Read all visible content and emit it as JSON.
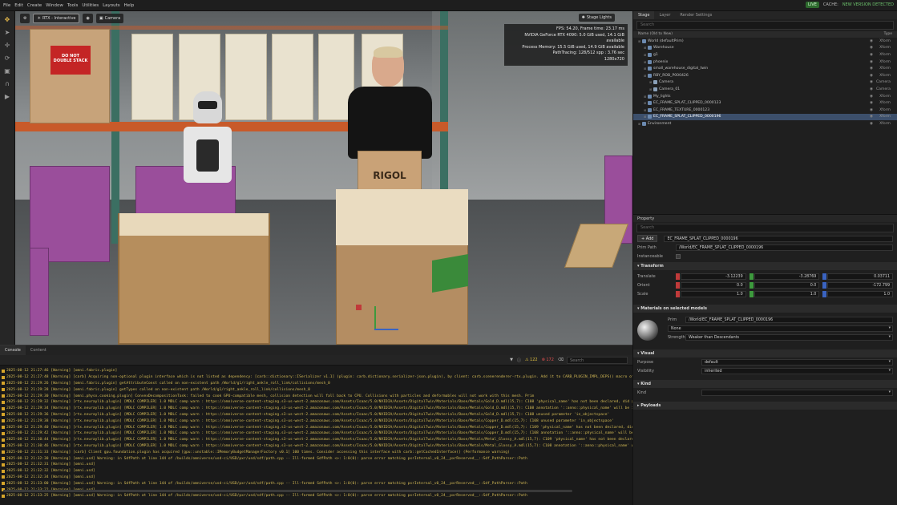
{
  "menu": [
    "File",
    "Edit",
    "Create",
    "Window",
    "Tools",
    "Utilities",
    "Layouts",
    "Help"
  ],
  "status": {
    "live": "LIVE",
    "cache": "CACHE:",
    "new_version": "NEW VERSION DETECTED"
  },
  "viewport": {
    "camera_mode": "RTX - Interactive",
    "camera": "Camera",
    "stage_lights": "Stage Lights",
    "stats": [
      "FPS: 54.20, Frame time: 23.17 ms",
      "NVIDIA GeForce RTX 4090: 5.0 GiB used, 14.1 GiB available",
      "Process Memory: 15.5 GiB used, 14.9 GiB available",
      "PathTracing: 128/512 spp : 3.76 sec",
      "1280x720"
    ],
    "scene_text": {
      "do_not_stack": "DO NOT\nDOUBLE STACK",
      "rigol": "RIGOL"
    }
  },
  "console": {
    "tabs": [
      "Console",
      "Content"
    ],
    "warn_count": "122",
    "error_count": "172",
    "search_placeholder": "Search",
    "lines": [
      {
        "t": "warn",
        "text": "2025-08-12 21:27:46 [Warning] [omni.fabric.plugin]"
      },
      {
        "t": "warn",
        "text": "2025-08-12 21:27:48 [Warning] [carb] Acquiring non-optional plugin interface which is not listed as dependency: [carb::dictionary::ISerializer v1.1] (plugin: carb.dictionary.serializer-json.plugin), by client: carb.scenerenderer-rtx.plugin. Add it to CARB_PLUGIN_IMPL_DEPS() macro of a client."
      },
      {
        "t": "warn",
        "text": "2025-08-12 21:29:26 [Warning] [omni.fabric.plugin] getAttributeConst called on non-existent path /World/g1/right_ankle_roll_link/collisions/mesh_0"
      },
      {
        "t": "warn",
        "text": "2025-08-12 21:29:28 [Warning] [omni.fabric.plugin] getTypes called on non-existent path /World/g1/right_ankle_roll_link/collisions/mesh_0"
      },
      {
        "t": "warn",
        "text": "2025-08-12 21:29:30 [Warning] [omni.physx.cooking.plugin] ConvexDecompositionTask: failed to cook GPU-compatible mesh, collision detection will fall back to CPU. Collisions with particles and deformables will not work with this mesh. Prim"
      },
      {
        "t": "warn",
        "text": "2025-08-12 21:29:32 [Warning] [rtx.neuraylib.plugin] [MDLC COMPILER]   1.0   MDLC   comp warn : https://omniverse-content-staging.s3-us-west-2.amazonaws.com/Assets/Isaac/5.0/NVIDIA/Assets/DigitalTwin/Materials/Base/Metals/Gold_D.mdl(15,7): C108 'physical_name' has not been declared, did yo"
      },
      {
        "t": "warn",
        "text": "2025-08-12 21:29:34 [Warning] [rtx.neuraylib.plugin] [MDLC COMPILER]   1.0   MDLC   comp warn : https://omniverse-content-staging.s3-us-west-2.amazonaws.com/Assets/Isaac/5.0/NVIDIA/Assets/DigitalTwin/Materials/Base/Metals/Gold_D.mdl(15,7): C108 annotation '::anno::physical_name' will be ignor"
      },
      {
        "t": "warn",
        "text": "2025-08-12 21:29:36 [Warning] [rtx.neuraylib.plugin] [MDLC COMPILER]   1.0   MDLC   comp warn : https://omniverse-content-staging.s3-us-west-2.amazonaws.com/Assets/Isaac/5.0/NVIDIA/Assets/DigitalTwin/Materials/Base/Metals/Gold_D.mdl(15,7): C108 unused parameter 'in_objectspace'"
      },
      {
        "t": "warn",
        "text": "2025-08-12 21:29:38 [Warning] [rtx.neuraylib.plugin] [MDLC COMPILER]   1.0   MDLC   comp warn : https://omniverse-content-staging.s3-us-west-2.amazonaws.com/Assets/Isaac/5.0/NVIDIA/Assets/DigitalTwin/Materials/Base/Metals/Copper_D.mdl(15,7): C108 unused parameter 'in_objectspace'"
      },
      {
        "t": "warn",
        "text": "2025-08-12 21:29:40 [Warning] [rtx.neuraylib.plugin] [MDLC COMPILER]   1.0   MDLC   comp warn : https://omniverse-content-staging.s3-us-west-2.amazonaws.com/Assets/Isaac/5.0/NVIDIA/Assets/DigitalTwin/Materials/Base/Metals/Copper_D.mdl(15,7): C109 'physical_name' has not been declared, did yo"
      },
      {
        "t": "warn",
        "text": "2025-08-12 21:29:42 [Warning] [rtx.neuraylib.plugin] [MDLC COMPILER]   1.0   MDLC   comp warn : https://omniverse-content-staging.s3-us-west-2.amazonaws.com/Assets/Isaac/5.0/NVIDIA/Assets/DigitalTwin/Materials/Base/Metals/Copper_D.mdl(15,7): C108 annotation '::anno::physical_name' will be ign"
      },
      {
        "t": "warn",
        "text": "2025-08-12 21:30:44 [Warning] [rtx.neuraylib.plugin] [MDLC COMPILER]   1.0   MDLC   comp warn : https://omniverse-content-staging.s3-us-west-2.amazonaws.com/Assets/Isaac/5.0/NVIDIA/Assets/DigitalTwin/Materials/Base/Metals/Metal_Glossy_A.mdl(15,7): C109 'physical_name' has not been declared"
      },
      {
        "t": "warn",
        "text": "2025-08-12 21:30:46 [Warning] [rtx.neuraylib.plugin] [MDLC COMPILER]   1.0   MDLC   comp warn : https://omniverse-content-staging.s3-us-west-2.amazonaws.com/Assets/Isaac/5.0/NVIDIA/Assets/DigitalTwin/Materials/Base/Metals/Metal_Glossy_A.mdl(15,7): C108 annotation '::anno::physical_name' will"
      },
      {
        "t": "warn",
        "text": "2025-08-12 21:31:33 [Warning] [carb] Client gpu.foundation.plugin has acquired [gpu::unstable::IMemoryBudgetManagerFactory v0.1] 100 times. Consider accessing this interface with carb::getCachedInterface() (Performance warning)"
      },
      {
        "t": "warn",
        "text": "2025-08-12 21:32:30 [Warning] [omni.usd] Warning: in SdfPath at line 144 of /builds/omniverse/usd-ci/USD/pxr/usd/sdf/path.cpp -- Ill-formed SdfPath <>: 1:0(0): parse error matching pxrInternal_v0_24__pxrReserved__::Sdf_PathParser::Path"
      },
      {
        "t": "warn",
        "text": "2025-08-12 21:32:31 [Warning] [omni.usd]"
      },
      {
        "t": "warn",
        "text": "2025-08-12 21:32:32 [Warning] [omni.usd]"
      },
      {
        "t": "warn",
        "text": "2025-08-12 21:32:34 [Warning] [omni.usd]"
      },
      {
        "t": "warn",
        "text": "2025-08-12 21:33:00 [Warning] [omni.usd] Warning: in SdfPath at line 144 of /builds/omniverse/usd-ci/USD/pxr/usd/sdf/path.cpp -- Ill-formed SdfPath <>: 1:0(0): parse error matching pxrInternal_v0_24__pxrReserved__::Sdf_PathParser::Path"
      },
      {
        "t": "warn",
        "text": "2025-08-12 21:33:22 [Warning] [omni.usd]"
      },
      {
        "t": "warn",
        "text": "2025-08-12 21:33:25 [Warning] [omni.usd] Warning: in SdfPath at line 144 of /builds/omniverse/usd-ci/USD/pxr/usd/sdf/path.cpp -- Ill-formed SdfPath <>: 1:0(0): parse error matching pxrInternal_v0_24__pxrReserved__::Sdf_PathParser::Path"
      }
    ]
  },
  "stage": {
    "tabs": [
      "Stage",
      "Layer",
      "Render Settings"
    ],
    "search_placeholder": "Search",
    "col_name": "Name (Old to New)",
    "col_type": "Type",
    "rows": [
      {
        "indent": 0,
        "label": "World (defaultPrim)",
        "type": "Xform",
        "sel": false
      },
      {
        "indent": 1,
        "label": "Warehouse",
        "type": "Xform",
        "sel": false
      },
      {
        "indent": 1,
        "label": "g1",
        "type": "Xform",
        "sel": false
      },
      {
        "indent": 1,
        "label": "phoenix",
        "type": "Xform",
        "sel": false
      },
      {
        "indent": 1,
        "label": "small_warehouse_digital_twin",
        "type": "Xform",
        "sel": false
      },
      {
        "indent": 1,
        "label": "RBY_ROB_P000426",
        "type": "Xform",
        "sel": false
      },
      {
        "indent": 2,
        "label": "Camera",
        "type": "Camera",
        "sel": false
      },
      {
        "indent": 2,
        "label": "Camera_01",
        "type": "Camera",
        "sel": false
      },
      {
        "indent": 1,
        "label": "My_lights",
        "type": "Xform",
        "sel": false
      },
      {
        "indent": 1,
        "label": "EC_FRAME_SPLAT_CLIPPED_0000123",
        "type": "Xform",
        "sel": false
      },
      {
        "indent": 1,
        "label": "EC_FRAME_TEXTURE_0000123",
        "type": "Xform",
        "sel": false
      },
      {
        "indent": 1,
        "label": "EC_FRAME_SPLAT_CLIPPED_0000196",
        "type": "Xform",
        "sel": true
      },
      {
        "indent": 0,
        "label": "Environment",
        "type": "Xform",
        "sel": false
      }
    ]
  },
  "property": {
    "tab": "Property",
    "search_placeholder": "Search",
    "add_label": "Add",
    "prim_name": "EC_FRAME_SPLAT_CLIPPED_0000196",
    "prim_path_label": "Prim Path",
    "prim_path": "/World/EC_FRAME_SPLAT_CLIPPED_0000196",
    "instanceable_label": "Instanceable",
    "transform_title": "Transform",
    "translate_label": "Translate",
    "translate": [
      "-3.12239",
      "-3.28769",
      "0.03711"
    ],
    "orient_label": "Orient",
    "orient": [
      "0.0",
      "0.0",
      "-172.799"
    ],
    "scale_label": "Scale",
    "scale": [
      "1.0",
      "1.0",
      "1.0"
    ],
    "materials_title": "Materials on selected models",
    "material_prim": "/World/EC_FRAME_SPLAT_CLIPPED_0000196",
    "prim_label": "Prim",
    "material_value": "None",
    "strength_label": "Strength",
    "strength_value": "Weaker than Descendants",
    "visual_title": "Visual",
    "purpose_label": "Purpose",
    "purpose_value": "default",
    "visibility_label": "Visibility",
    "visibility_value": "inherited",
    "kind_title": "Kind",
    "kind_label": "Kind",
    "kind_value": "",
    "payloads_title": "Payloads"
  }
}
